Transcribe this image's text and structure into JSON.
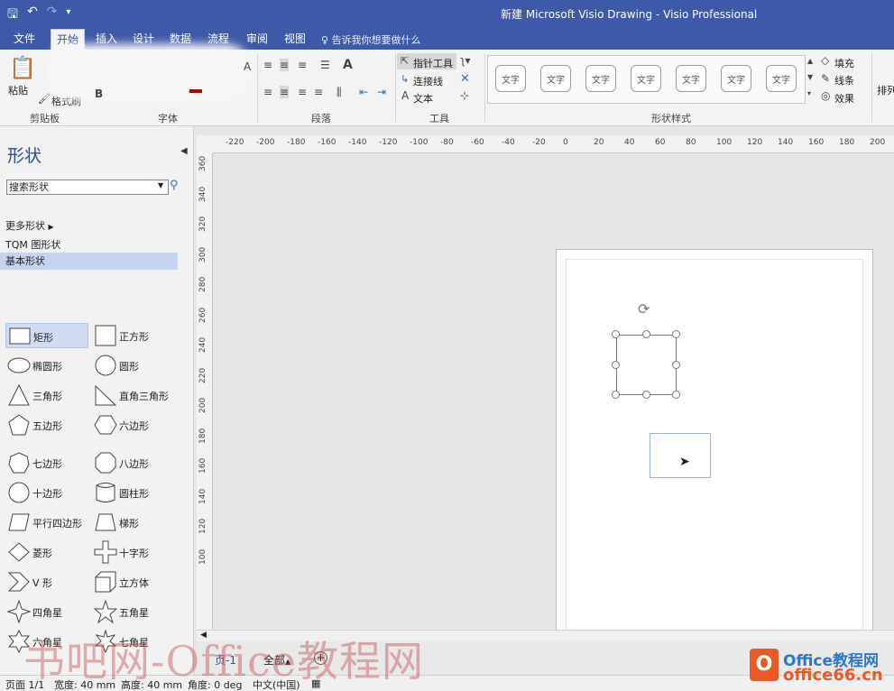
{
  "title_bar": {
    "title": "新建 Microsoft Visio Drawing  -  Visio Professional"
  },
  "tabs": [
    "文件",
    "开始",
    "插入",
    "设计",
    "数据",
    "流程",
    "审阅",
    "视图"
  ],
  "tell_me": "告诉我你想要做什么",
  "ribbon": {
    "clipboard": {
      "paste": "粘贴",
      "format_painter": "格式刷",
      "label": "剪贴板"
    },
    "font": {
      "label": "字体"
    },
    "paragraph": {
      "label": "段落"
    },
    "tools": {
      "pointer": "指针工具",
      "connector": "连接线",
      "text": "文本",
      "label": "工具"
    },
    "shape_styles": {
      "style_text": "文字",
      "label": "形状样式"
    },
    "fill": "填充",
    "line": "线条",
    "effect": "效果",
    "arrange": "排列"
  },
  "shapes_panel": {
    "title": "形状",
    "search_placeholder": "搜索形状",
    "more_shapes": "更多形状",
    "categories": [
      "TQM 图形状",
      "基本形状"
    ],
    "items": [
      {
        "label": "矩形",
        "icon": "rectangle-icon"
      },
      {
        "label": "正方形",
        "icon": "square-icon"
      },
      {
        "label": "椭圆形",
        "icon": "ellipse-icon"
      },
      {
        "label": "圆形",
        "icon": "circle-icon"
      },
      {
        "label": "三角形",
        "icon": "triangle-icon"
      },
      {
        "label": "直角三角形",
        "icon": "right-triangle-icon"
      },
      {
        "label": "五边形",
        "icon": "pentagon-icon"
      },
      {
        "label": "六边形",
        "icon": "hexagon-icon"
      },
      {
        "label": "七边形",
        "icon": "heptagon-icon"
      },
      {
        "label": "八边形",
        "icon": "octagon-icon"
      },
      {
        "label": "十边形",
        "icon": "decagon-icon"
      },
      {
        "label": "圆柱形",
        "icon": "cylinder-icon"
      },
      {
        "label": "平行四边形",
        "icon": "parallelogram-icon"
      },
      {
        "label": "梯形",
        "icon": "trapezoid-icon"
      },
      {
        "label": "菱形",
        "icon": "diamond-icon"
      },
      {
        "label": "十字形",
        "icon": "cross-icon"
      },
      {
        "label": "V 形",
        "icon": "chevron-icon"
      },
      {
        "label": "立方体",
        "icon": "cube-icon"
      },
      {
        "label": "四角星",
        "icon": "star4-icon"
      },
      {
        "label": "五角星",
        "icon": "star5-icon"
      },
      {
        "label": "六角星",
        "icon": "star6-icon"
      },
      {
        "label": "七角星",
        "icon": "star7-icon"
      }
    ]
  },
  "ruler_h": [
    "-220",
    "-200",
    "-180",
    "-160",
    "-140",
    "-120",
    "-100",
    "-80",
    "-60",
    "-40",
    "-20",
    "0",
    "20",
    "40",
    "60",
    "80",
    "100",
    "120",
    "140",
    "160",
    "180",
    "200"
  ],
  "ruler_v": [
    "360",
    "340",
    "320",
    "300",
    "280",
    "260",
    "240",
    "220",
    "200",
    "180",
    "160",
    "140",
    "120",
    "100"
  ],
  "page_tabs": {
    "page1": "页-1",
    "all": "全部",
    "add": "+"
  },
  "status_bar": {
    "page": "页面 1/1",
    "width": "宽度: 40 mm",
    "height": "高度: 40 mm",
    "angle": "角度: 0 deg",
    "language": "中文(中国)"
  },
  "watermark": "书吧网-Office教程网",
  "logo": {
    "line1": "Office教程网",
    "line2": "office66.cn",
    "badge": "O"
  },
  "colors": {
    "accent": "#3c5aa8",
    "selection": "#c5d3ef",
    "watermark_logo": "#e95a24"
  }
}
